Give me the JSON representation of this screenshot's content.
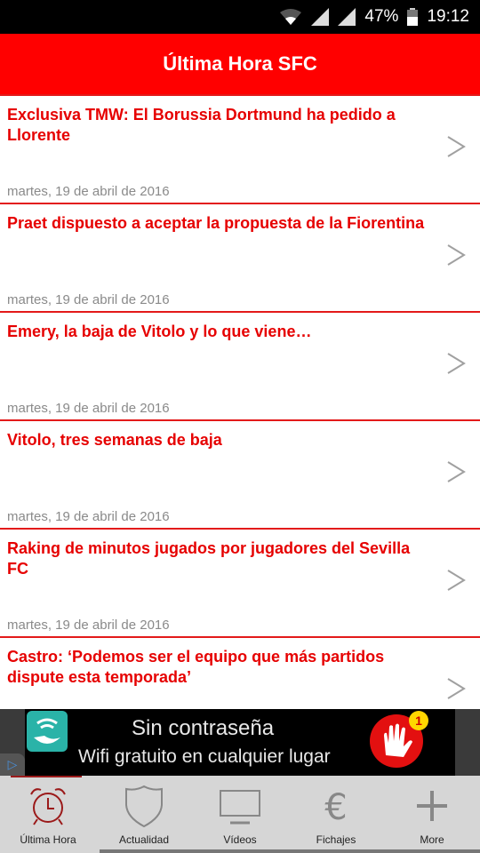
{
  "status_bar": {
    "battery": "47%",
    "time": "19:12"
  },
  "app_bar": {
    "title": "Última Hora SFC"
  },
  "colors": {
    "accent": "#ff0000",
    "title_text": "#e60000",
    "date_text": "#8a8a8a",
    "tab_active": "#9b1a1a"
  },
  "news": [
    {
      "title": "Exclusiva TMW: El Borussia Dortmund ha pedido a Llorente",
      "date": "martes, 19 de abril de 2016"
    },
    {
      "title": "Praet dispuesto a aceptar la propuesta de la Fiorentina",
      "date": "martes, 19 de abril de 2016"
    },
    {
      "title": "Emery, la baja de Vitolo y lo que viene…",
      "date": "martes, 19 de abril de 2016"
    },
    {
      "title": "Vitolo, tres semanas de baja",
      "date": "martes, 19 de abril de 2016"
    },
    {
      "title": "Raking de minutos jugados por jugadores del Sevilla FC",
      "date": "martes, 19 de abril de 2016"
    },
    {
      "title": "Castro: ‘Podemos ser el equipo que más partidos dispute esta temporada’",
      "date": ""
    }
  ],
  "ad": {
    "line1": "Sin contraseña",
    "line2": "Wifi gratuito en cualquier lugar",
    "badge": "1"
  },
  "tabs": [
    {
      "label": "Última Hora",
      "icon": "alarm-clock-icon",
      "active": true
    },
    {
      "label": "Actualidad",
      "icon": "shield-icon",
      "active": false
    },
    {
      "label": "Vídeos",
      "icon": "tv-icon",
      "active": false
    },
    {
      "label": "Fichajes",
      "icon": "euro-icon",
      "active": false
    },
    {
      "label": "More",
      "icon": "plus-icon",
      "active": false
    }
  ]
}
